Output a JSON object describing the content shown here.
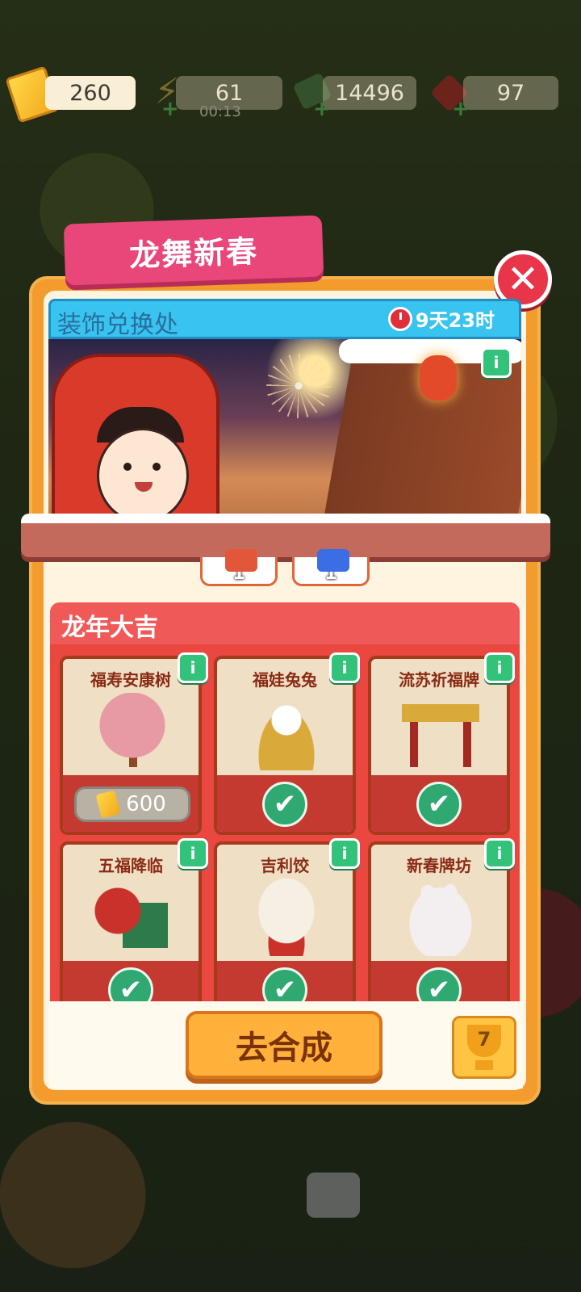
{
  "resources": {
    "tickets": "260",
    "energy": "61",
    "energy_timer": "00:13",
    "cash": "14496",
    "gems": "97"
  },
  "event": {
    "title": "龙舞新春",
    "banner_title": "装饰兑换处",
    "countdown": "9天23时"
  },
  "rewards": [
    "1",
    "1"
  ],
  "section": {
    "title": "龙年大吉",
    "items": [
      {
        "name": "福寿安康树",
        "status": "price",
        "price": "600"
      },
      {
        "name": "福娃兔兔",
        "status": "owned"
      },
      {
        "name": "流苏祈福牌",
        "status": "owned"
      },
      {
        "name": "五福降临",
        "status": "owned"
      },
      {
        "name": "吉利饺",
        "status": "owned"
      },
      {
        "name": "新春牌坊",
        "status": "owned"
      }
    ]
  },
  "buttons": {
    "go_merge": "去合成",
    "trophy_count": "7",
    "close": "✕",
    "info": "i",
    "check": "✔"
  }
}
